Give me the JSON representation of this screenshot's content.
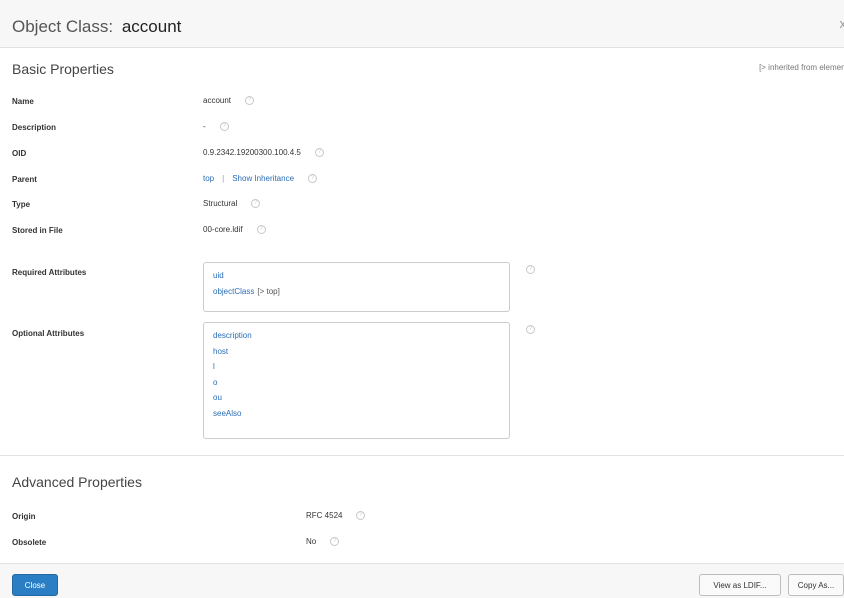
{
  "header": {
    "title_prefix": "Object Class:",
    "object_name": "account",
    "close_glyph": "x"
  },
  "basic": {
    "section_title": "Basic Properties",
    "inherited_note": "[> inherited from element]",
    "name_label": "Name",
    "name_value": "account",
    "description_label": "Description",
    "description_value": "-",
    "oid_label": "OID",
    "oid_value": "0.9.2342.19200300.100.4.5",
    "parent_label": "Parent",
    "parent_link": "top",
    "parent_separator": "|",
    "show_inheritance": "Show Inheritance",
    "type_label": "Type",
    "type_value": "Structural",
    "stored_label": "Stored in File",
    "stored_value": "00-core.ldif",
    "required_label": "Required Attributes",
    "required_attrs": [
      {
        "name": "uid",
        "suffix": ""
      },
      {
        "name": "objectClass",
        "suffix": "[> top]"
      }
    ],
    "optional_label": "Optional Attributes",
    "optional_attrs": [
      "description",
      "host",
      "l",
      "o",
      "ou",
      "seeAlso"
    ]
  },
  "advanced": {
    "section_title": "Advanced Properties",
    "origin_label": "Origin",
    "origin_value": "RFC 4524",
    "obsolete_label": "Obsolete",
    "obsolete_value": "No"
  },
  "footer": {
    "close_label": "Close",
    "view_ldif_label": "View as LDIF...",
    "copy_as_label": "Copy As..."
  },
  "icons": {
    "help": "help-circle-icon",
    "close": "close-icon"
  },
  "colors": {
    "link": "#2a6db5",
    "primary_button": "#2a7fc4",
    "header_bg": "#f7f7f7"
  }
}
